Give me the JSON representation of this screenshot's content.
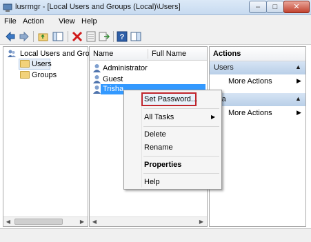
{
  "window": {
    "title": "lusrmgr - [Local Users and Groups (Local)\\Users]"
  },
  "title_controls": {
    "minimize": "–",
    "maximize": "□",
    "close": "✕"
  },
  "menu": [
    "File",
    "Action",
    "View",
    "Help"
  ],
  "toolbar_icons": [
    "back-arrow-icon",
    "forward-arrow-icon",
    "up-folder-icon",
    "show-hide-tree-icon",
    "delete-icon",
    "properties-icon",
    "export-list-icon",
    "help-icon",
    "action-pane-icon"
  ],
  "tree": {
    "root": "Local Users and Grou",
    "children": [
      "Users",
      "Groups"
    ]
  },
  "list": {
    "columns": [
      "Name",
      "Full Name"
    ],
    "rows": [
      "Administrator",
      "Guest",
      "Trisha"
    ],
    "selected": "Trisha"
  },
  "actions": {
    "header": "Actions",
    "sections": [
      {
        "title": "Users",
        "link": "More Actions"
      },
      {
        "title": "sha",
        "link": "More Actions"
      }
    ]
  },
  "context_menu": {
    "items": [
      "Set Password...",
      "All Tasks",
      "Delete",
      "Rename",
      "Properties",
      "Help"
    ],
    "highlighted": "Set Password...",
    "submenu_item": "All Tasks",
    "bold_item": "Properties",
    "highlight_color": "#c0252c"
  }
}
